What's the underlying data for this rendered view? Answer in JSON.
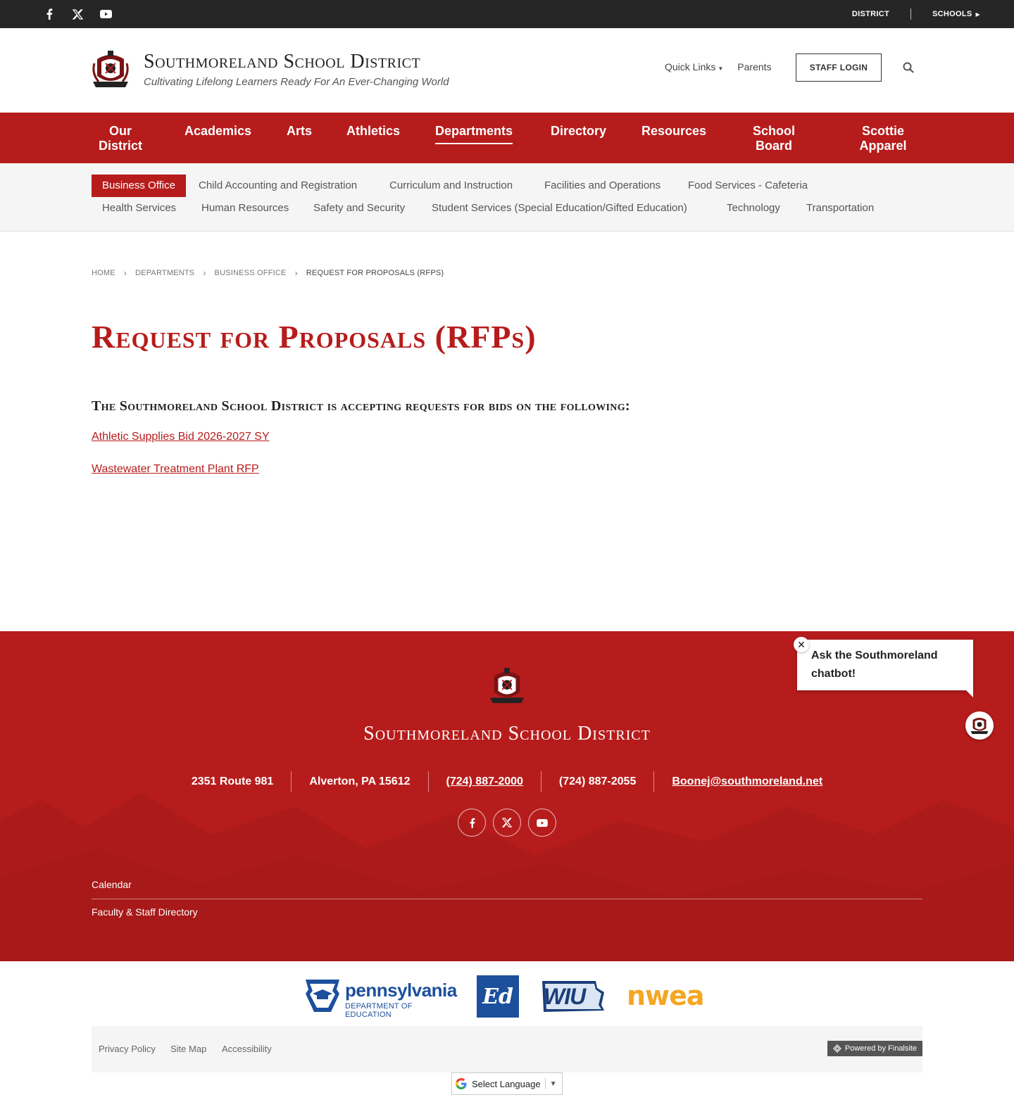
{
  "topbar": {
    "social": [
      {
        "icon": "facebook-icon",
        "label": "f"
      },
      {
        "icon": "x-icon",
        "label": "𝕏"
      },
      {
        "icon": "youtube-icon",
        "label": "▶"
      }
    ],
    "district": "DISTRICT",
    "schools": "SCHOOLS"
  },
  "header": {
    "site_name": "Southmoreland School District",
    "tagline": "Cultivating Lifelong Learners Ready For An Ever-Changing World",
    "quick_links": "Quick Links",
    "parents": "Parents",
    "staff_login": "STAFF LOGIN"
  },
  "nav": {
    "our_district": "Our District",
    "academics": "Academics",
    "arts": "Arts",
    "athletics": "Athletics",
    "departments": "Departments",
    "directory": "Directory",
    "resources": "Resources",
    "school_board": "School Board",
    "scottie_apparel": "Scottie Apparel"
  },
  "subnav": {
    "business_office": "Business Office",
    "child_accounting": "Child Accounting and Registration",
    "curriculum": "Curriculum and Instruction",
    "facilities": "Facilities and Operations",
    "food_services": "Food Services - Cafeteria",
    "health": "Health Services",
    "hr": "Human Resources",
    "safety": "Safety and Security",
    "student_services": "Student Services (Special Education/Gifted Education)",
    "technology": "Technology",
    "transportation": "Transportation"
  },
  "breadcrumb": {
    "home": "HOME",
    "departments": "DEPARTMENTS",
    "business_office": "BUSINESS OFFICE",
    "current": "REQUEST FOR PROPOSALS (RFPS)"
  },
  "content": {
    "title": "Request for Proposals (RFPs)",
    "intro": "The Southmoreland School District is accepting requests for bids on the following:",
    "links": [
      "Athletic Supplies Bid 2026-2027 SY",
      "Wastewater Treatment Plant RFP"
    ]
  },
  "footer": {
    "name": "Southmoreland School District",
    "address": "2351 Route 981",
    "city": "Alverton, PA  15612",
    "phone": "(724) 887-2000",
    "fax": "(724) 887-2055",
    "email": "Boonej@southmoreland.net",
    "links": [
      "Calendar",
      "Faculty & Staff Directory"
    ]
  },
  "chatbot": {
    "message": "Ask the Southmoreland chatbot!",
    "close": "✕"
  },
  "partners": {
    "pde_name": "pennsylvania",
    "pde_sub": "DEPARTMENT OF EDUCATION",
    "ed": "Ed",
    "wiu": "WIU",
    "nwea": "nwea"
  },
  "bottom": {
    "privacy": "Privacy Policy",
    "sitemap": "Site Map",
    "accessibility": "Accessibility",
    "powered": "Powered by Finalsite"
  },
  "translate": {
    "label": "Select Language"
  },
  "colors": {
    "brand_red": "#b71c1c",
    "topbar": "#262626",
    "nwea_orange": "#f5a623",
    "pde_blue": "#1c4f9c"
  }
}
